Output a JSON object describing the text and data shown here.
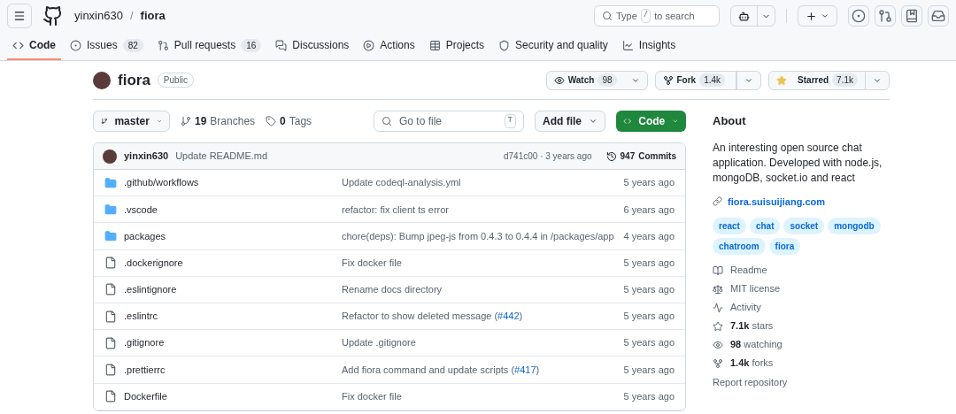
{
  "header": {
    "owner": "yinxin630",
    "separator": "/",
    "repo": "fiora",
    "search_parts": [
      {
        "text": "Type"
      },
      {
        "key": "/"
      },
      {
        "text": "to search"
      }
    ]
  },
  "tabs": [
    {
      "label": "Code",
      "selected": true
    },
    {
      "label": "Issues",
      "count": "82",
      "selected": false
    },
    {
      "label": "Pull requests",
      "count": "16",
      "selected": false
    },
    {
      "label": "Discussions",
      "selected": false
    },
    {
      "label": "Actions",
      "selected": false
    },
    {
      "label": "Projects",
      "selected": false
    },
    {
      "label": "Security and quality",
      "selected": false
    },
    {
      "label": "Insights",
      "selected": false
    }
  ],
  "repo": {
    "name": "fiora",
    "visibility": "Public",
    "watch": {
      "label": "Watch",
      "count": "98"
    },
    "fork": {
      "label": "Fork",
      "count": "1.4k"
    },
    "star": {
      "label": "Starred",
      "count": "7.1k"
    }
  },
  "toolbar": {
    "branch": "master",
    "branches_count": "19",
    "branches_label": "Branches",
    "tags_count": "0",
    "tags_label": "Tags",
    "go_to_file": "Go to file",
    "shortcut": "T",
    "add_file": "Add file",
    "code": "Code"
  },
  "commit": {
    "author": "yinxin630",
    "message": "Update README.md",
    "hash_age": "d741c00 · 3 years ago",
    "commits_count": "947",
    "commits_label": "Commits"
  },
  "files": [
    {
      "name": ".github/workflows",
      "kind": "folder",
      "message_parts": [
        {
          "text": "Update codeql-analysis.yml"
        }
      ],
      "age": "5 years ago"
    },
    {
      "name": ".vscode",
      "kind": "folder",
      "message_parts": [
        {
          "text": "refactor: fix client ts error"
        }
      ],
      "age": "6 years ago"
    },
    {
      "name": "packages",
      "kind": "folder",
      "message_parts": [
        {
          "text": "chore(deps): Bump jpeg-js from 0.4.3 to 0.4.4 in /packages/app"
        }
      ],
      "age": "4 years ago"
    },
    {
      "name": ".dockerignore",
      "kind": "file",
      "message_parts": [
        {
          "text": "Fix docker file"
        }
      ],
      "age": "5 years ago"
    },
    {
      "name": ".eslintignore",
      "kind": "file",
      "message_parts": [
        {
          "text": "Rename docs directory"
        }
      ],
      "age": "5 years ago"
    },
    {
      "name": ".eslintrc",
      "kind": "file",
      "message_parts": [
        {
          "text": "Refactor to show deleted message ("
        },
        {
          "link": "#442"
        },
        {
          "text": ")"
        }
      ],
      "age": "5 years ago"
    },
    {
      "name": ".gitignore",
      "kind": "file",
      "message_parts": [
        {
          "text": "Update .gitignore"
        }
      ],
      "age": "5 years ago"
    },
    {
      "name": ".prettierrc",
      "kind": "file",
      "message_parts": [
        {
          "text": "Add fiora command and update scripts ("
        },
        {
          "link": "#417"
        },
        {
          "text": ")"
        }
      ],
      "age": "5 years ago"
    },
    {
      "name": "Dockerfile",
      "kind": "file",
      "message_parts": [
        {
          "text": "Fix docker file"
        }
      ],
      "age": "5 years ago"
    }
  ],
  "about": {
    "title": "About",
    "description": "An interesting open source chat application. Developed with node.js, mongoDB, socket.io and react",
    "website": "fiora.suisuijiang.com",
    "topics": [
      "react",
      "chat",
      "socket",
      "mongodb",
      "chatroom",
      "fiora"
    ],
    "links": [
      {
        "parts": [
          {
            "text": "Readme"
          }
        ]
      },
      {
        "parts": [
          {
            "text": "MIT license"
          }
        ]
      },
      {
        "parts": [
          {
            "text": "Activity"
          }
        ]
      },
      {
        "parts": [
          {
            "bold": "7.1k"
          },
          {
            "text": "stars"
          }
        ]
      },
      {
        "parts": [
          {
            "bold": "98"
          },
          {
            "text": "watching"
          }
        ]
      },
      {
        "parts": [
          {
            "bold": "1.4k"
          },
          {
            "text": "forks"
          }
        ]
      }
    ],
    "report": "Report repository"
  }
}
